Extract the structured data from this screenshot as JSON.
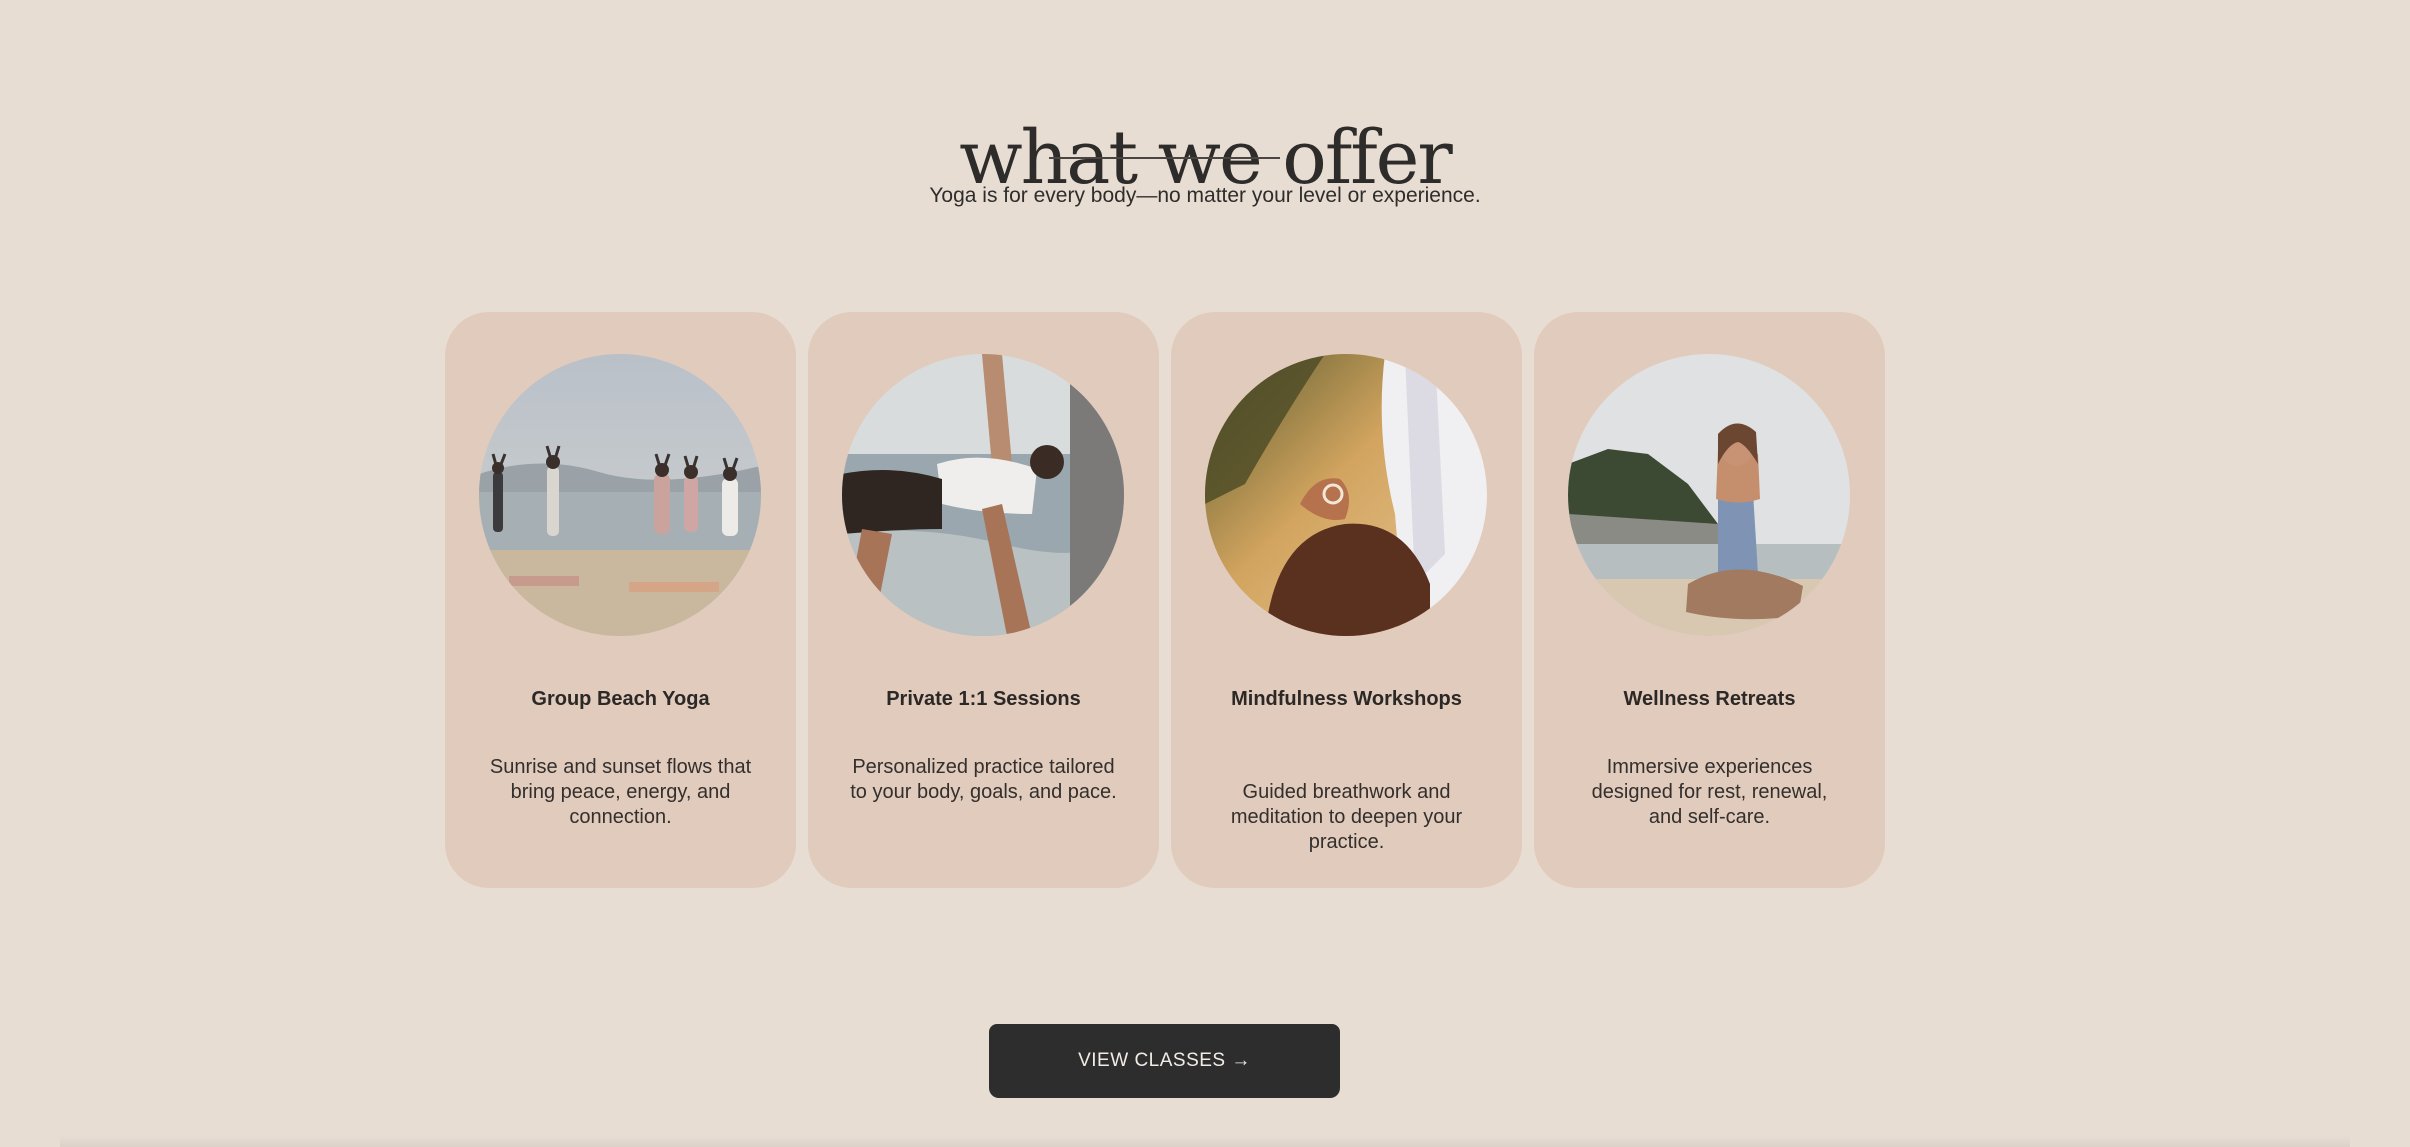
{
  "section": {
    "heading": "what we offer",
    "subtitle": "Yoga is for every body—no matter your level or experience."
  },
  "cards": [
    {
      "title": "Group Beach Yoga",
      "description": "Sunrise and sunset flows that bring peace, energy, and connection.",
      "image_icon": "group-beach-yoga-photo"
    },
    {
      "title": "Private 1:1 Sessions",
      "description": "Personalized practice tailored to your body, goals, and pace.",
      "image_icon": "private-session-photo"
    },
    {
      "title": "Mindfulness Workshops",
      "description": "Guided breathwork and meditation to deepen your practice.",
      "image_icon": "mindfulness-photo"
    },
    {
      "title": "Wellness Retreats",
      "description": "Immersive experiences designed for rest, renewal, and self-care.",
      "image_icon": "wellness-retreat-photo"
    }
  ],
  "cta": {
    "label": "VIEW CLASSES →"
  },
  "colors": {
    "page_background": "#e8ddd3",
    "card_background": "#e1cbbd",
    "button_background": "#2d2d2d",
    "text": "#2b2b2b"
  }
}
